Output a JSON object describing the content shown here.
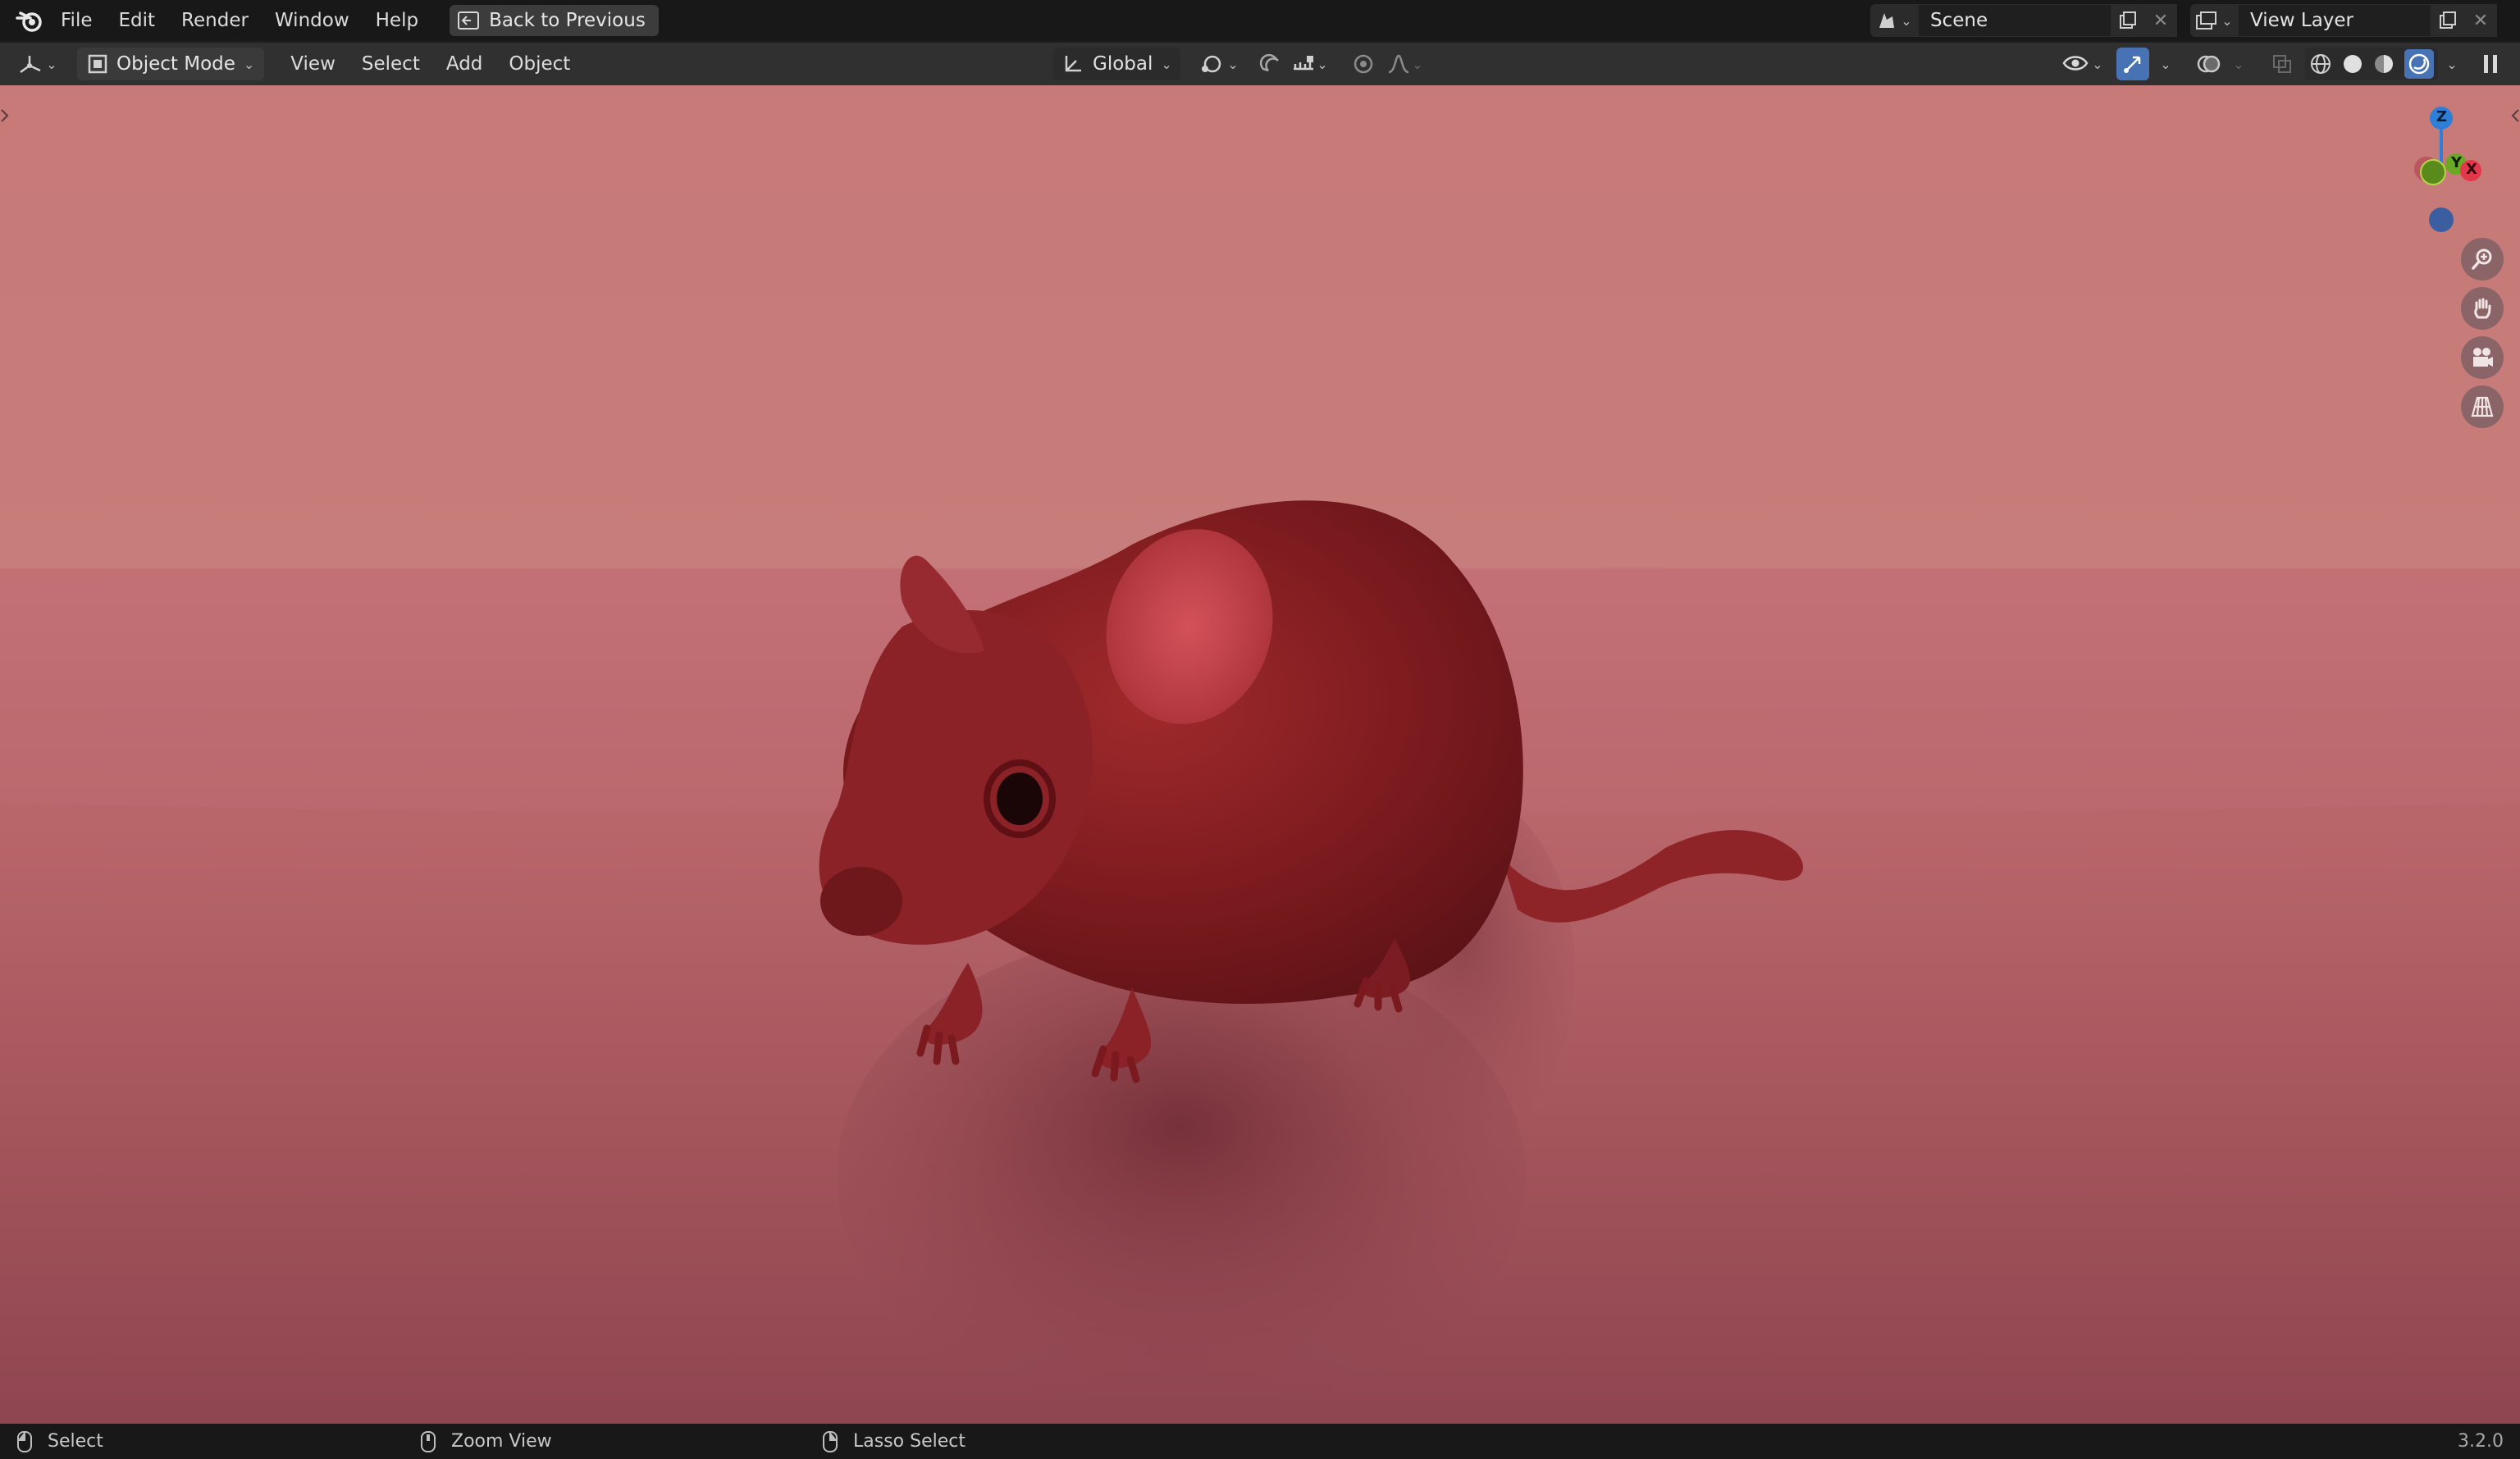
{
  "topbar": {
    "menus": [
      "File",
      "Edit",
      "Render",
      "Window",
      "Help"
    ],
    "back_button": "Back to Previous",
    "scene_name": "Scene",
    "view_layer_name": "View Layer"
  },
  "header": {
    "mode": "Object Mode",
    "menus": [
      "View",
      "Select",
      "Add",
      "Object"
    ],
    "transform_orientation": "Global"
  },
  "gizmo": {
    "z_label": "Z",
    "y_label": "Y",
    "x_label": "X"
  },
  "statusbar": {
    "select": "Select",
    "zoom": "Zoom View",
    "lasso": "Lasso Select",
    "version": "3.2.0"
  },
  "colors": {
    "accent": "#4772b3",
    "axis_x": "#e3374b",
    "axis_y": "#6ba824",
    "axis_z": "#2f7fd8"
  }
}
